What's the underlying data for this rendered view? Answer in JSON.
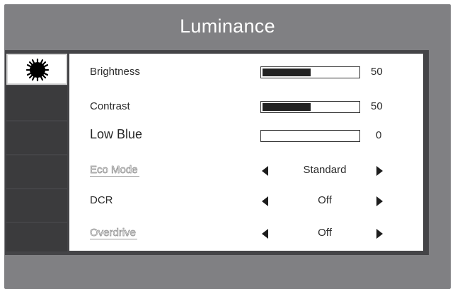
{
  "osd": {
    "title": "Luminance",
    "tabs": [
      {
        "name": "luminance-tab",
        "icon": "sun-icon",
        "active": true
      },
      {
        "name": "tab-2",
        "active": false
      },
      {
        "name": "tab-3",
        "active": false
      },
      {
        "name": "tab-4",
        "active": false
      },
      {
        "name": "tab-5",
        "active": false
      },
      {
        "name": "tab-6",
        "active": false
      }
    ],
    "rows": [
      {
        "label": "Brightness",
        "value": "50",
        "level": 0.5,
        "enabled": true
      },
      {
        "label": "Contrast",
        "value": "50",
        "level": 0.5,
        "enabled": true
      },
      {
        "label": "Low Blue",
        "value": "0",
        "level": 0,
        "enabled": true
      },
      {
        "label": "Eco Mode",
        "option": "Standard",
        "enabled": false
      },
      {
        "label": "DCR",
        "option": "Off",
        "enabled": true
      },
      {
        "label": "Overdrive",
        "option": "Off",
        "enabled": false
      }
    ]
  },
  "colors": {
    "osd_background": "#808083",
    "tab_column": "#3b3b3d",
    "panel": "#ffffff",
    "bar_fill": "#222222"
  }
}
